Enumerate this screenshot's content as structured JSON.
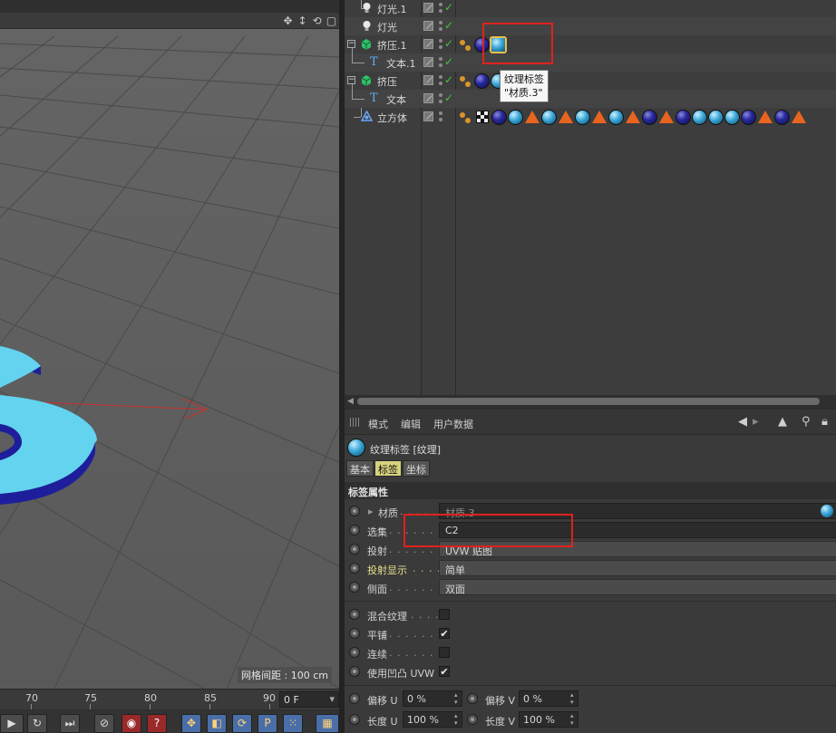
{
  "viewport": {
    "grid_spacing_label": "网格间距 : 100 cm",
    "nav_icons": [
      "move-view-icon",
      "dolly-icon",
      "rotate-view-icon",
      "maximize-icon"
    ]
  },
  "object_manager": {
    "objects": [
      {
        "name": "灯光.1",
        "icon": "light-bulb-icon",
        "tags": []
      },
      {
        "name": "灯光",
        "icon": "light-bulb-icon",
        "tags": []
      },
      {
        "name": "挤压.1",
        "icon": "extrude-icon",
        "tags": [
          "phong",
          "material-dark",
          "material-cyan-selected"
        ]
      },
      {
        "name": "文本.1",
        "icon": "text-spline-icon",
        "tags": []
      },
      {
        "name": "挤压",
        "icon": "extrude-icon",
        "tags": [
          "phong",
          "material-dark",
          "material-cyan"
        ]
      },
      {
        "name": "文本",
        "icon": "text-spline-icon",
        "tags": []
      },
      {
        "name": "立方体",
        "icon": "cube-icon",
        "tags": [
          "phong",
          "checker",
          "dark",
          "cyan",
          "tri",
          "cyan",
          "tri",
          "cyan",
          "tri",
          "cyan",
          "tri",
          "dark",
          "tri",
          "dark",
          "cyan",
          "cyan",
          "cyan",
          "dark",
          "tri",
          "dark",
          "tri"
        ]
      }
    ],
    "tooltip": {
      "line1": "纹理标签",
      "line2": "\"材质.3\""
    }
  },
  "attribute_manager": {
    "menu": {
      "mode": "模式",
      "edit": "编辑",
      "user_data": "用户数据"
    },
    "title": "纹理标签 [纹理]",
    "tabs": [
      {
        "label": "基本",
        "active": false
      },
      {
        "label": "标签",
        "active": true
      },
      {
        "label": "坐标",
        "active": false
      }
    ],
    "section": "标签属性",
    "properties": {
      "material": {
        "label": "材质",
        "value": "材质.3"
      },
      "selection": {
        "label": "选集",
        "value": "C2"
      },
      "projection": {
        "label": "投射",
        "value": "UVW 贴图"
      },
      "projection_display": {
        "label": "投射显示",
        "value": "简单"
      },
      "side": {
        "label": "侧面",
        "value": "双面"
      },
      "mix_textures": {
        "label": "混合纹理",
        "checked": false
      },
      "tile": {
        "label": "平铺",
        "checked": true
      },
      "seamless": {
        "label": "连续",
        "checked": false
      },
      "use_bump_uvw": {
        "label": "使用凹凸 UVW",
        "checked": true
      },
      "offset_u": {
        "label": "偏移 U",
        "value": "0 %"
      },
      "offset_v": {
        "label": "偏移 V",
        "value": "0 %"
      },
      "length_u": {
        "label": "长度 U",
        "value": "100 %"
      },
      "length_v": {
        "label": "长度 V",
        "value": "100 %"
      }
    }
  },
  "timeline": {
    "ticks": [
      "70",
      "75",
      "80",
      "85",
      "90"
    ],
    "current_frame": "0 F"
  },
  "colors": {
    "viewport_bg": "#5f5f5f",
    "extrude_face": "#63d3ef",
    "extrude_side": "#1e1e9c",
    "highlight_red": "#e0211d",
    "active_tab": "#d7d27e"
  }
}
